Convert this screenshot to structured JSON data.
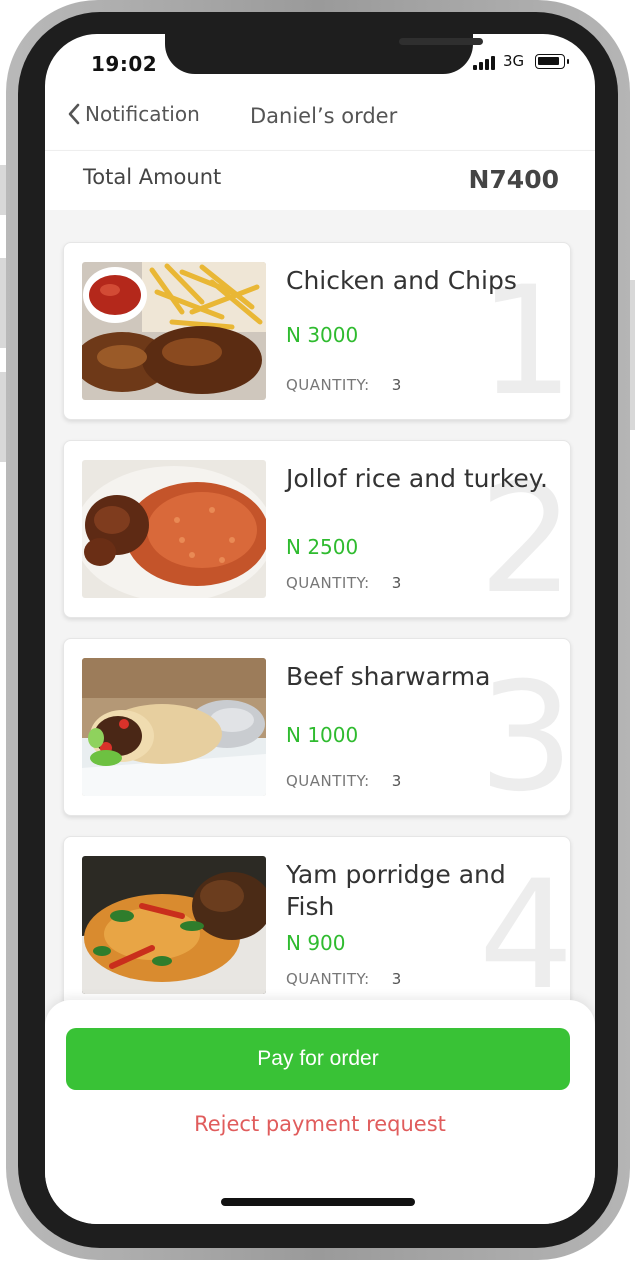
{
  "status": {
    "time": "19:02",
    "network": "3G"
  },
  "nav": {
    "back_label": "Notification",
    "title": "Daniel’s order"
  },
  "summary": {
    "label": "Total Amount",
    "value": "N7400"
  },
  "orders": [
    {
      "index": "1",
      "name": "Chicken and Chips",
      "price": "N 3000",
      "quantity_label": "QUANTITY:",
      "quantity": "3"
    },
    {
      "index": "2",
      "name": "Jollof rice and turkey.",
      "price": "N 2500",
      "quantity_label": "QUANTITY:",
      "quantity": "3"
    },
    {
      "index": "3",
      "name": "Beef sharwarma",
      "price": "N 1000",
      "quantity_label": "QUANTITY:",
      "quantity": "3"
    },
    {
      "index": "4",
      "name": "Yam porridge and Fish",
      "price": "N 900",
      "quantity_label": "QUANTITY:",
      "quantity": "3"
    }
  ],
  "actions": {
    "pay_label": "Pay for order",
    "reject_label": "Reject payment request"
  },
  "colors": {
    "accent_green": "#39c236",
    "price_green": "#2fbb2f",
    "reject_red": "#e05c5c"
  }
}
